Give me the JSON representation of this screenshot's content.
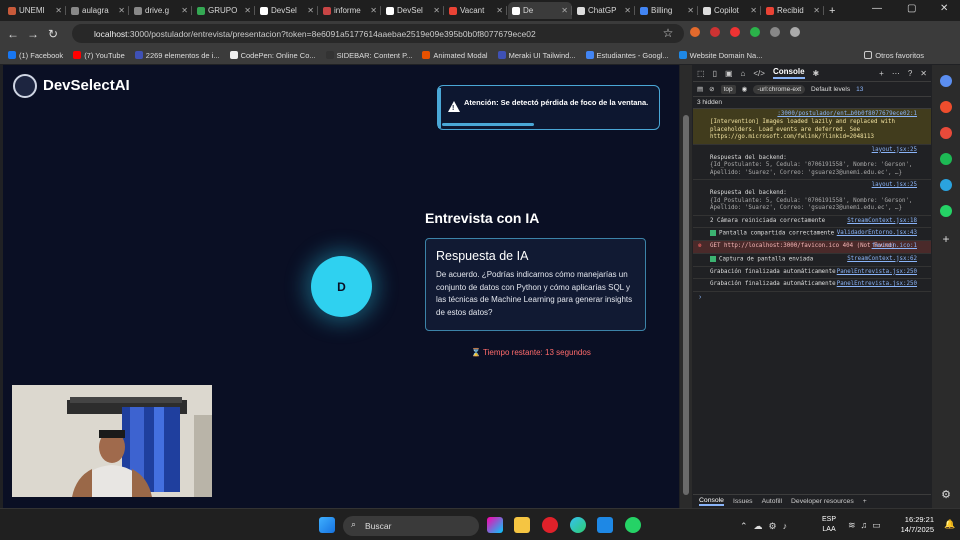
{
  "tabs": [
    {
      "label": "UNEMI",
      "color": "#c85a3a"
    },
    {
      "label": "aulagra",
      "color": "#888888"
    },
    {
      "label": "drive.g",
      "color": "#888888"
    },
    {
      "label": "GRUPO",
      "color": "#34a853"
    },
    {
      "label": "DevSel",
      "color": "#ffffff"
    },
    {
      "label": "informe",
      "color": "#c84545"
    },
    {
      "label": "DevSel",
      "color": "#ffffff"
    },
    {
      "label": "Vacant",
      "color": "#ea4335"
    },
    {
      "label": "De",
      "color": "#ffffff",
      "active": true
    },
    {
      "label": "ChatGP",
      "color": "#dddddd"
    },
    {
      "label": "Billing",
      "color": "#4285f4"
    },
    {
      "label": "Copilot",
      "color": "#dddddd"
    },
    {
      "label": "Recibid",
      "color": "#ea4335"
    }
  ],
  "address": {
    "host": "localhost",
    "path": ":3000/postulador/entrevista/presentacion?token=8e6091a5177614aaebae2519e09e395b0b0f8077679ece02"
  },
  "bookmarks": [
    {
      "label": "(1) Facebook",
      "color": "#1877f2"
    },
    {
      "label": "(7) YouTube",
      "color": "#ff0000"
    },
    {
      "label": "2269 elementos de i...",
      "color": "#3f51b5"
    },
    {
      "label": "CodePen: Online Co...",
      "color": "#eeeeee"
    },
    {
      "label": "SIDEBAR: Content P...",
      "color": "#333333"
    },
    {
      "label": "Animated Modal",
      "color": "#e65100"
    },
    {
      "label": "Meraki UI Tailwind...",
      "color": "#3f51b5"
    },
    {
      "label": "Estudiantes - Googl...",
      "color": "#4285f4"
    },
    {
      "label": "Website Domain Na...",
      "color": "#1e88e5"
    }
  ],
  "other_favorites": "Otros favoritos",
  "app": {
    "brand": "DevSelectAI",
    "alert": "Atención: Se detectó pérdida de foco de la ventana.",
    "interview_title": "Entrevista con IA",
    "avatar_letter": "D",
    "card_title": "Respuesta de IA",
    "card_text": "De acuerdo. ¿Podrías indicarnos cómo manejarías un conjunto de datos con Python y cómo aplicarías SQL y las técnicas de Machine Learning para generar insights de estos datos?",
    "timer": "Tiempo restante: 13 segundos"
  },
  "devtools": {
    "tabs": [
      "Console"
    ],
    "filter": {
      "context": "top",
      "filter_text": "-url:chrome-ext",
      "levels": "Default levels",
      "count": "13"
    },
    "hidden": "3 hidden",
    "logs": [
      {
        "type": "warn",
        "text": "[Intervention] Images loaded lazily and replaced with placeholders. Load events are deferred. See https://go.microsoft.com/fwlink/?linkid=2048113",
        "src": ":3000/postulador/ent…b0b0f8077679ece02:1"
      },
      {
        "type": "info",
        "text": "Respuesta del backend:",
        "obj": "{Id_Postulante: 5, Cedula: '0706191558', Nombre: 'Gerson', Apellido: 'Suarez', Correo: 'gsuarez3@unemi.edu.ec', …}",
        "src": "layout.jsx:25"
      },
      {
        "type": "info",
        "text": "Respuesta del backend:",
        "obj": "{Id_Postulante: 5, Cedula: '0706191558', Nombre: 'Gerson', Apellido: 'Suarez', Correo: 'gsuarez3@unemi.edu.ec', …}",
        "src": "layout.jsx:25"
      },
      {
        "type": "info",
        "text": "2 Cámara reiniciada correctamente",
        "src": "StreamContext.jsx:18"
      },
      {
        "type": "ok",
        "text": "Pantalla compartida correctamente",
        "src": "ValidadorEntorno.jsx:43"
      },
      {
        "type": "err",
        "text": "GET http://localhost:3000/favicon.ico 404 (Not Found)",
        "src": "favicon.ico:1"
      },
      {
        "type": "ok",
        "text": "Captura de pantalla enviada",
        "src": "StreamContext.jsx:62"
      },
      {
        "type": "info",
        "text": "Grabación finalizada automáticamente",
        "src": "PanelEntrevista.jsx:250"
      },
      {
        "type": "info",
        "text": "Grabación finalizada automáticamente",
        "src": "PanelEntrevista.jsx:250"
      }
    ],
    "bottom_tabs": [
      "Console",
      "Issues",
      "Autofill",
      "Developer resources"
    ]
  },
  "taskbar": {
    "search": "Buscar",
    "lang": "ESP",
    "lang2": "LAA",
    "time": "16:29:21",
    "date": "14/7/2025"
  }
}
